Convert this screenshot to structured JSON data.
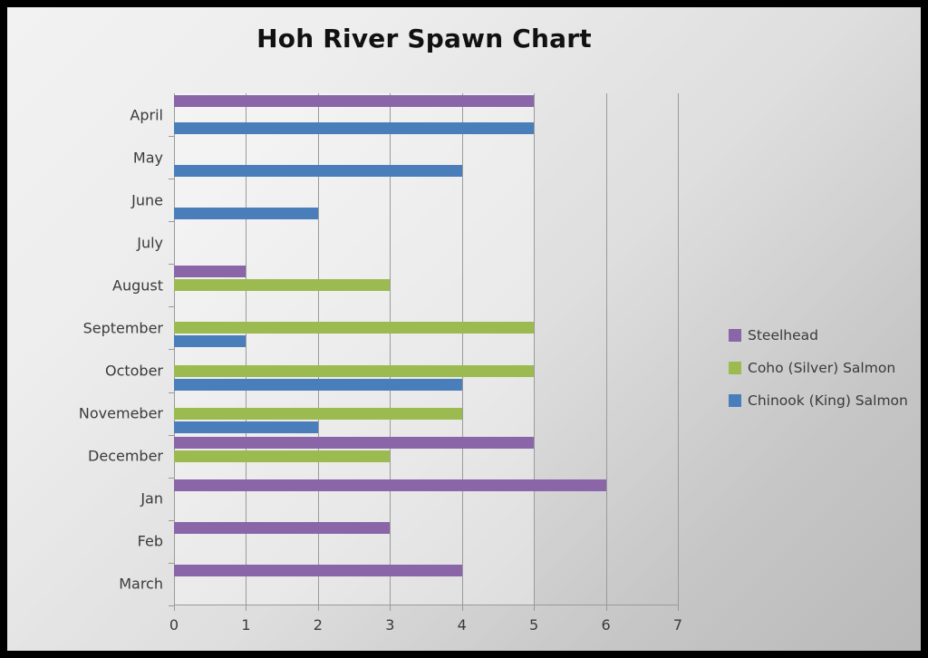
{
  "chart_data": {
    "type": "bar",
    "orientation": "horizontal",
    "title": "Hoh River Spawn Chart",
    "xlabel": "",
    "ylabel": "",
    "xlim": [
      0,
      7
    ],
    "xticks": [
      "0",
      "1",
      "2",
      "3",
      "4",
      "5",
      "6",
      "7"
    ],
    "grid": "vertical",
    "legend_position": "right",
    "categories": [
      "April",
      "May",
      "June",
      "July",
      "August",
      "September",
      "October",
      "Novemeber",
      "December",
      "Jan",
      "Feb",
      "March"
    ],
    "series": [
      {
        "name": "Steelhead",
        "color": "#8a65a8",
        "values": [
          5,
          0,
          0,
          0,
          1,
          0,
          0,
          0,
          5,
          6,
          3,
          4
        ]
      },
      {
        "name": "Coho (Silver) Salmon",
        "color": "#9bbb50",
        "values": [
          0,
          0,
          0,
          0,
          3,
          5,
          5,
          4,
          3,
          0,
          0,
          0
        ]
      },
      {
        "name": "Chinook (King) Salmon",
        "color": "#4a7ebb",
        "values": [
          5,
          4,
          2,
          0,
          0,
          1,
          4,
          2,
          0,
          0,
          0,
          0
        ]
      }
    ]
  },
  "legend": {
    "items": [
      {
        "label": "Steelhead",
        "color": "#8a65a8"
      },
      {
        "label": "Coho (Silver) Salmon",
        "color": "#9bbb50"
      },
      {
        "label": "Chinook (King) Salmon",
        "color": "#4a7ebb"
      }
    ]
  },
  "frame": {
    "border_color": "#000000",
    "background_start": "#f2f2f2",
    "background_end": "#b9b9b9"
  }
}
